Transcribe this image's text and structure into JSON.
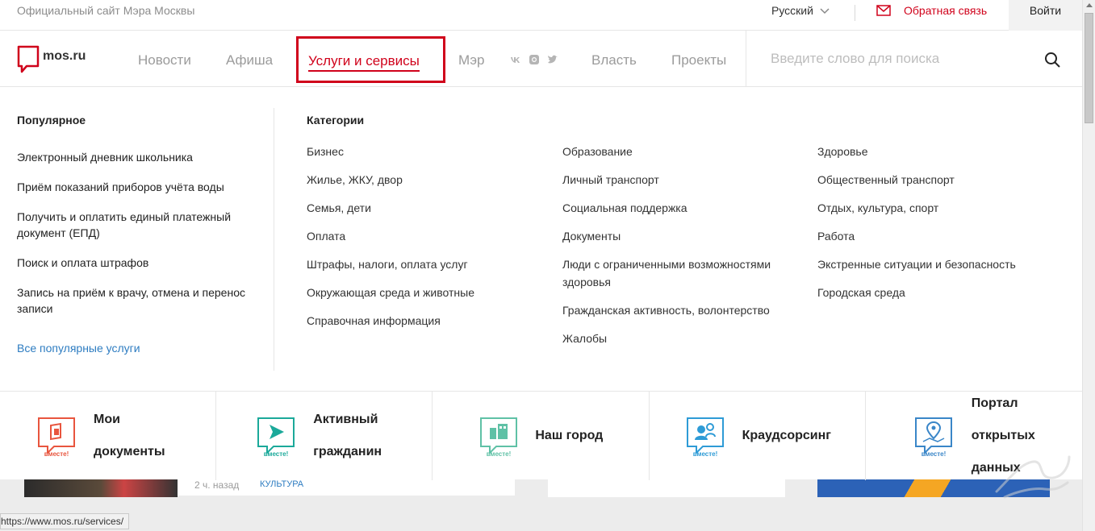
{
  "topbar": {
    "official": "Официальный сайт Мэра Москвы",
    "language": "Русский",
    "feedback": "Обратная связь",
    "login": "Войти"
  },
  "nav": {
    "logo_text": "mos.ru",
    "items": {
      "news": "Новости",
      "afisha": "Афиша",
      "services": "Услуги и сервисы",
      "mayor": "Мэр",
      "power": "Власть",
      "projects": "Проекты"
    },
    "search_placeholder": "Введите слово для поиска",
    "accent": "#d0021b"
  },
  "popular": {
    "title": "Популярное",
    "items": [
      "Электронный дневник школьника",
      "Приём показаний приборов учёта воды",
      "Получить и оплатить единый платежный документ (ЕПД)",
      "Поиск и оплата штрафов",
      "Запись на приём к врачу, отмена и перенос записи"
    ],
    "all_link": "Все популярные услуги"
  },
  "categories": {
    "title": "Категории",
    "col1": [
      "Бизнес",
      "Жилье, ЖКУ, двор",
      "Семья, дети",
      "Оплата",
      "Штрафы, налоги, оплата услуг",
      "Окружающая среда и животные",
      "Справочная информация"
    ],
    "col2": [
      "Образование",
      "Личный транспорт",
      "Социальная поддержка",
      "Документы",
      "Люди с ограниченными возможностями здоровья",
      "Гражданская активность, волонтерство",
      "Жалобы"
    ],
    "col3": [
      "Здоровье",
      "Общественный транспорт",
      "Отдых, культура, спорт",
      "Работа",
      "Экстренные ситуации и безопасность",
      "Городская среда"
    ]
  },
  "tiles": [
    {
      "line1": "Мои",
      "line2": "документы",
      "icon": "documents-icon",
      "color": "#e8553e"
    },
    {
      "line1": "Активный",
      "line2": "гражданин",
      "icon": "active-citizen-icon",
      "color": "#1ba99a"
    },
    {
      "line1": "Наш город",
      "icon": "our-city-icon",
      "color": "#5fc1a6"
    },
    {
      "line1": "Краудсорсинг",
      "icon": "crowdsourcing-icon",
      "color": "#2e9bd6"
    },
    {
      "line1": "Портал",
      "line2": "открытых",
      "line3": "данных",
      "icon": "open-data-icon",
      "color": "#3a86c8"
    }
  ],
  "tile_badge": "вместе!",
  "background": {
    "ago": "2 ч. назад",
    "tag": "КУЛЬТУРА"
  },
  "statusbar": "https://www.mos.ru/services/"
}
